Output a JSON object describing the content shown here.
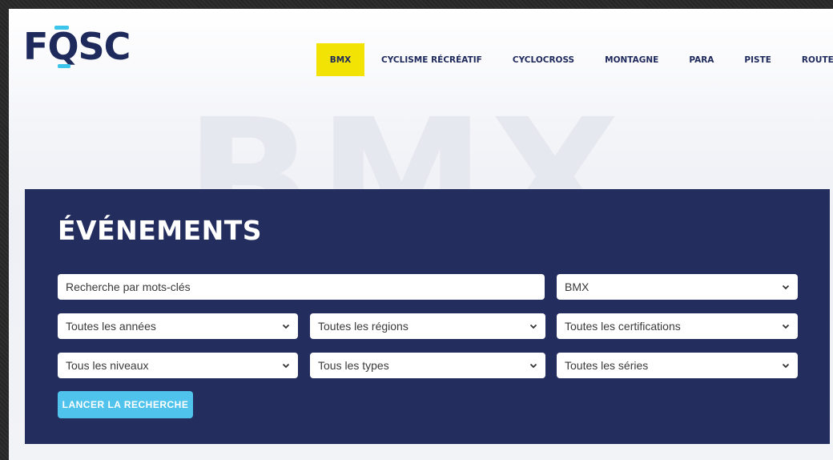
{
  "brand": {
    "logo_text_left": "F",
    "logo_text_q": "Q",
    "logo_text_right": "SC",
    "accent": "#3cc4ea",
    "navy": "#1f2a5c"
  },
  "watermark": "BMX",
  "nav": {
    "items": [
      {
        "label": "BMX",
        "active": true
      },
      {
        "label": "CYCLISME RÉCRÉATIF"
      },
      {
        "label": "CYCLOCROSS"
      },
      {
        "label": "MONTAGNE"
      },
      {
        "label": "PARA"
      },
      {
        "label": "PISTE"
      },
      {
        "label": "ROUTE"
      }
    ],
    "active_color": "#f2e304"
  },
  "events": {
    "title": "ÉVÉNEMENTS",
    "search": {
      "placeholder": "Recherche par mots-clés",
      "value": ""
    },
    "discipline_select": "BMX",
    "filters": {
      "years": "Toutes les années",
      "regions": "Toutes les régions",
      "certifications": "Toutes les certifications",
      "levels": "Tous les niveaux",
      "types": "Tous les types",
      "series": "Toutes les séries"
    },
    "submit_label": "LANCER LA RECHERCHE",
    "panel_color": "#232d5e",
    "button_color": "#4fc3ec"
  }
}
